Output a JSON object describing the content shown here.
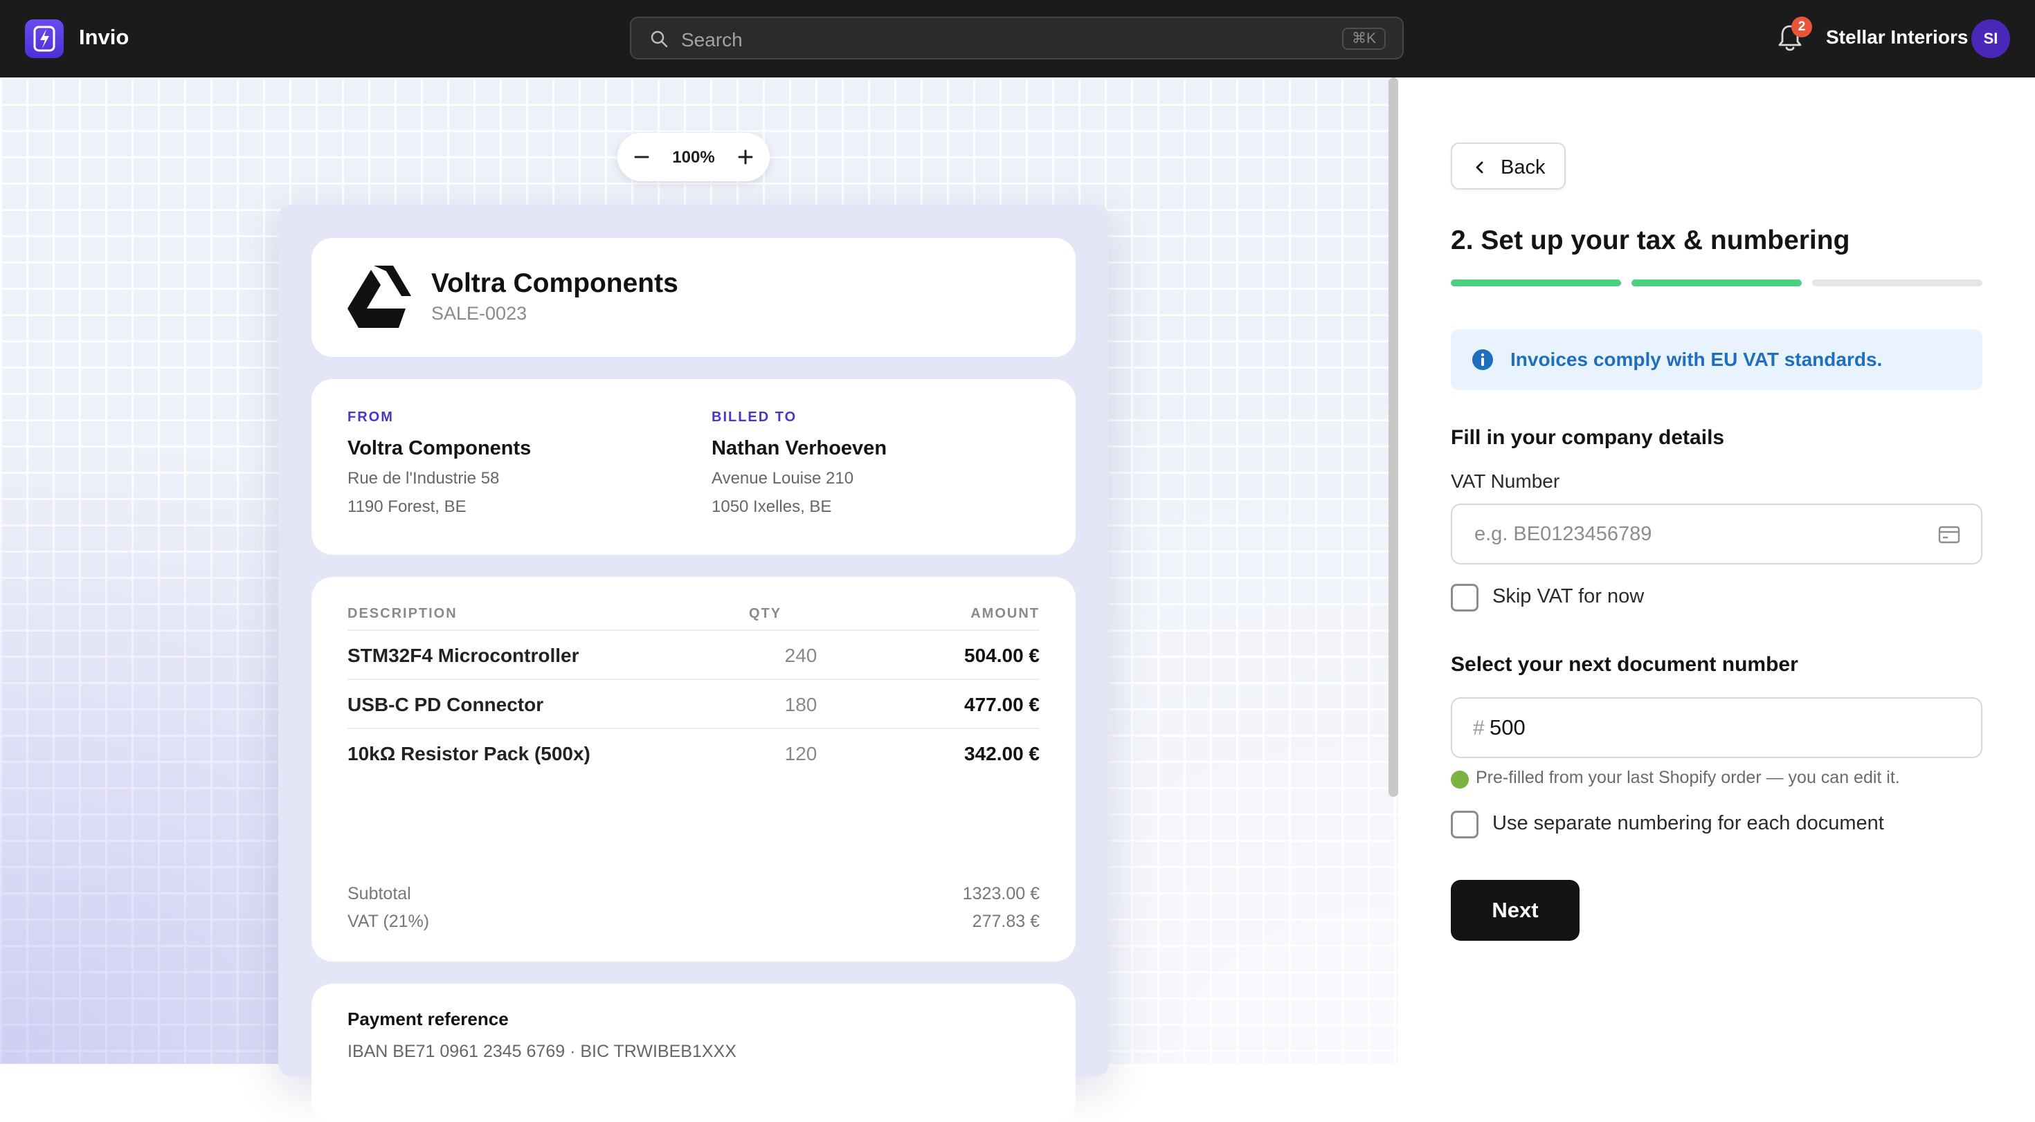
{
  "app": {
    "name": "Invio"
  },
  "search": {
    "placeholder": "Search",
    "shortcut": "⌘K"
  },
  "notifications": {
    "count": "2"
  },
  "account": {
    "company": "Stellar Interiors",
    "initials": "SI"
  },
  "zoom": {
    "level": "100%"
  },
  "invoice": {
    "seller": "Voltra Components",
    "number": "SALE-0023",
    "from": {
      "label": "FROM",
      "name": "Voltra Components",
      "line1": "Rue de l'Industrie 58",
      "line2": "1190 Forest, BE"
    },
    "billed_to": {
      "label": "BILLED TO",
      "name": "Nathan Verhoeven",
      "line1": "Avenue Louise 210",
      "line2": "1050 Ixelles, BE"
    },
    "columns": {
      "description": "DESCRIPTION",
      "qty": "QTY",
      "amount": "AMOUNT"
    },
    "items": [
      {
        "description": "STM32F4 Microcontroller",
        "qty": "240",
        "amount": "504.00 €"
      },
      {
        "description": "USB-C PD Connector",
        "qty": "180",
        "amount": "477.00 €"
      },
      {
        "description": "10kΩ Resistor Pack (500x)",
        "qty": "120",
        "amount": "342.00 €"
      }
    ],
    "subtotal_label": "Subtotal",
    "subtotal": "1323.00 €",
    "vat_label": "VAT (21%)",
    "vat": "277.83 €",
    "payment_title": "Payment reference",
    "payment_value": "IBAN BE71 0961 2345 6769 · BIC TRWIBEB1XXX"
  },
  "setup": {
    "back_label": "Back",
    "title": "2. Set up your tax & numbering",
    "progress_steps": [
      {
        "done": true
      },
      {
        "done": true
      },
      {
        "done": false
      }
    ],
    "colors": {
      "done": "#4ccf7f",
      "pending": "#e6e6e6"
    },
    "info": "Invoices comply with EU VAT standards.",
    "company_section": "Fill in your company details",
    "vat_label": "VAT Number",
    "vat_placeholder": "e.g. BE0123456789",
    "skip_vat_label": "Skip VAT for now",
    "numbering_section": "Select your next document number",
    "next_number": "500",
    "number_prefix": "#",
    "prefill_hint": "Pre-filled from your last Shopify order — you can edit it.",
    "separate_numbering_label": "Use separate numbering for each document",
    "next_label": "Next"
  }
}
